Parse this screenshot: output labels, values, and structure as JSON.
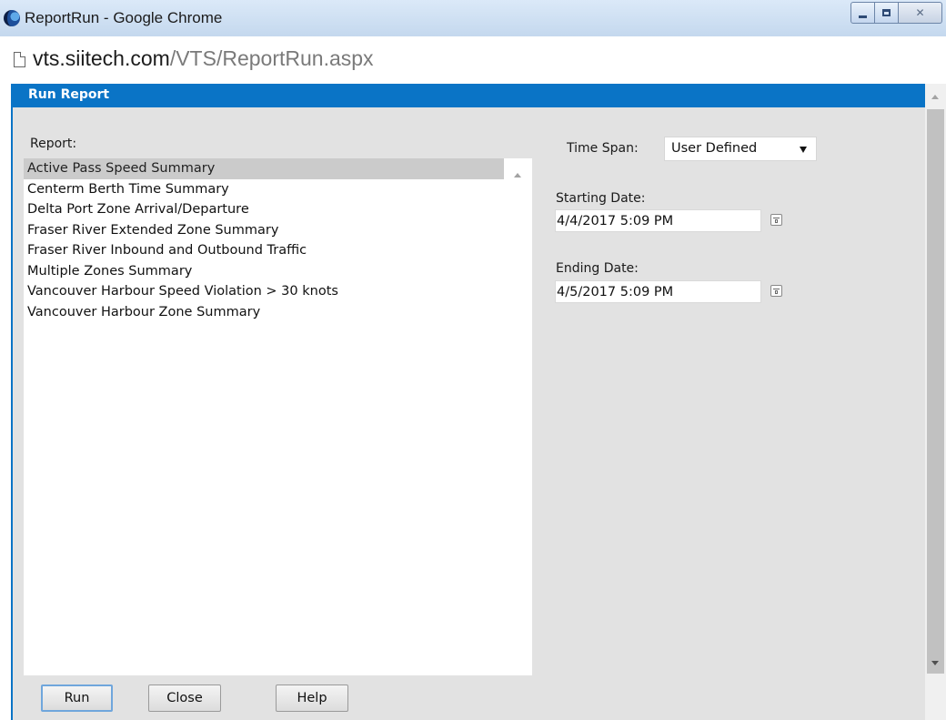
{
  "window": {
    "title": "ReportRun - Google Chrome",
    "url_host": "vts.siitech.com",
    "url_path": "/VTS/ReportRun.aspx"
  },
  "panel": {
    "title": "Run Report"
  },
  "report": {
    "label": "Report:",
    "selected_index": 0,
    "items": [
      "Active Pass Speed Summary",
      "Centerm Berth Time Summary",
      "Delta Port Zone Arrival/Departure",
      "Fraser River Extended Zone Summary",
      "Fraser River Inbound and Outbound Traffic",
      "Multiple Zones Summary",
      "Vancouver Harbour Speed Violation > 30 knots",
      "Vancouver Harbour Zone Summary"
    ]
  },
  "time_span": {
    "label": "Time Span:",
    "value": "User Defined"
  },
  "starting_date": {
    "label": "Starting Date:",
    "value": "4/4/2017 5:09 PM"
  },
  "ending_date": {
    "label": "Ending Date:",
    "value": "4/5/2017 5:09 PM"
  },
  "buttons": {
    "run": "Run",
    "close": "Close",
    "help": "Help"
  },
  "colors": {
    "panel_header": "#0a74c6",
    "content_bg": "#e2e2e2",
    "selected_item": "#cbcbcb"
  },
  "icons": {
    "app": "chrome-app-icon",
    "page": "page-icon",
    "calendar": "calendar-icon"
  }
}
